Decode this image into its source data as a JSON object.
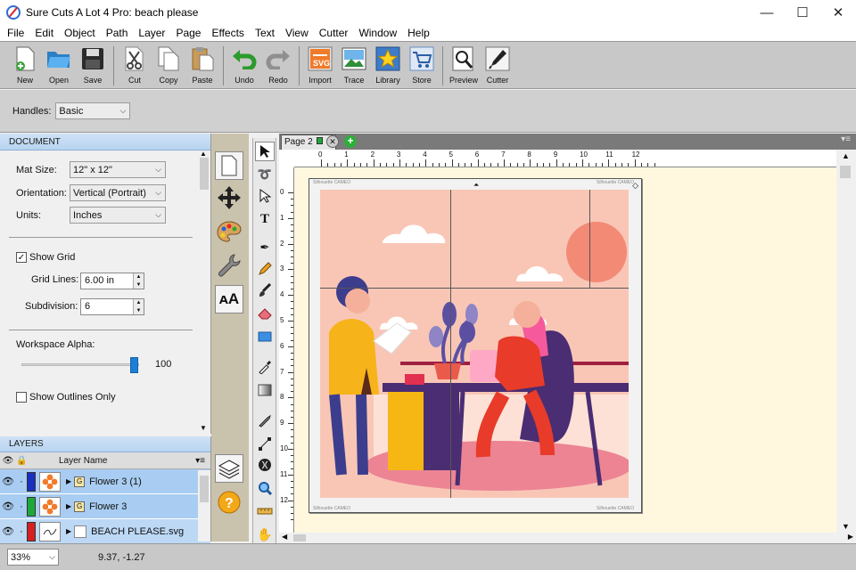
{
  "window": {
    "title": "Sure Cuts A Lot 4 Pro: beach please",
    "min": "—",
    "max": "☐",
    "close": "✕"
  },
  "menu": [
    "File",
    "Edit",
    "Object",
    "Path",
    "Layer",
    "Page",
    "Effects",
    "Text",
    "View",
    "Cutter",
    "Window",
    "Help"
  ],
  "toolbar": {
    "new": "New",
    "open": "Open",
    "save": "Save",
    "cut": "Cut",
    "copy": "Copy",
    "paste": "Paste",
    "undo": "Undo",
    "redo": "Redo",
    "import": "Import",
    "trace": "Trace",
    "library": "Library",
    "store": "Store",
    "preview": "Preview",
    "cutter": "Cutter"
  },
  "handles": {
    "label": "Handles:",
    "value": "Basic"
  },
  "document": {
    "header": "DOCUMENT",
    "mat_size_label": "Mat Size:",
    "mat_size": "12\" x 12\"",
    "orientation_label": "Orientation:",
    "orientation": "Vertical (Portrait)",
    "units_label": "Units:",
    "units": "Inches",
    "show_grid_label": "Show Grid",
    "show_grid": true,
    "grid_lines_label": "Grid Lines:",
    "grid_lines": "6.00 in",
    "subdivision_label": "Subdivision:",
    "subdivision": "6",
    "workspace_alpha_label": "Workspace Alpha:",
    "workspace_alpha": "100",
    "show_outlines_label": "Show Outlines Only",
    "show_outlines": false
  },
  "layers": {
    "header": "LAYERS",
    "col_name": "Layer Name",
    "rows": [
      {
        "name": "Flower 3 (1)",
        "color": "#1a2fbf"
      },
      {
        "name": "Flower 3",
        "color": "#1fa83a"
      },
      {
        "name": "BEACH PLEASE.svg",
        "color": "#d42020"
      }
    ]
  },
  "canvas": {
    "tab_label": "Page 2",
    "ruler_top": [
      "0",
      "1",
      "2",
      "3",
      "4",
      "5",
      "6",
      "7",
      "8",
      "9",
      "10",
      "11",
      "12"
    ],
    "ruler_left": [
      "0",
      "1",
      "2",
      "3",
      "4",
      "5",
      "6",
      "7",
      "8",
      "9",
      "10",
      "11",
      "12"
    ],
    "mat_brand_top_left": "Silhouette CAMEO",
    "mat_brand_top_right": "Silhouette CAMEO",
    "mat_brand_bottom_left": "Silhouette CAMEO",
    "mat_brand_bottom_right": "Silhouette CAMEO"
  },
  "status": {
    "zoom": "33%",
    "coords": "9.37, -1.27"
  }
}
